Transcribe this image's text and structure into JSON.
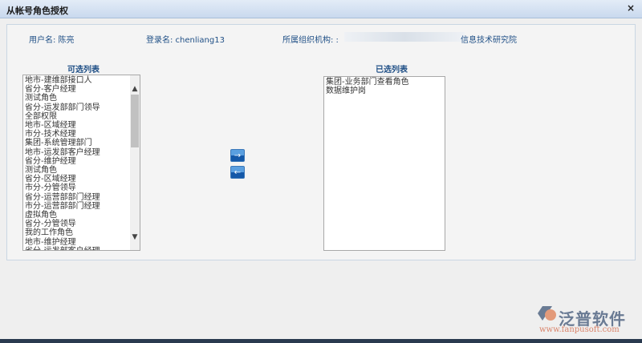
{
  "dialog": {
    "title": "从帐号角色授权",
    "close": "×"
  },
  "info": {
    "user_label": "用户名: 陈亮",
    "login_label": "登录名: chenliang13",
    "org_label": "所属组织机构: :",
    "org_value": "信息技术研究院"
  },
  "available": {
    "title": "可选列表",
    "items": [
      "地市-建维部接口人",
      "省分-客户经理",
      "测试角色",
      "省分-运发部部门领导",
      "全部权限",
      "地市-区域经理",
      "市分-技术经理",
      "集团-系统管理部门",
      "地市-运发部客户经理",
      "省分-维护经理",
      "测试角色",
      "省分-区域经理",
      "市分-分管领导",
      "省分-运营部部门经理",
      "市分-运营部部门经理",
      "虚拟角色",
      "省分-分管领导",
      "我的工作角色",
      "地市-维护经理",
      "省分-运发部客户经理"
    ]
  },
  "selected": {
    "title": "已选列表",
    "items": [
      "集团-业务部门查看角色",
      "数据维护岗"
    ]
  },
  "buttons": {
    "add": "→",
    "remove": "←"
  },
  "logo": {
    "name": "泛普软件",
    "url": "www.fanpusoft.com"
  }
}
